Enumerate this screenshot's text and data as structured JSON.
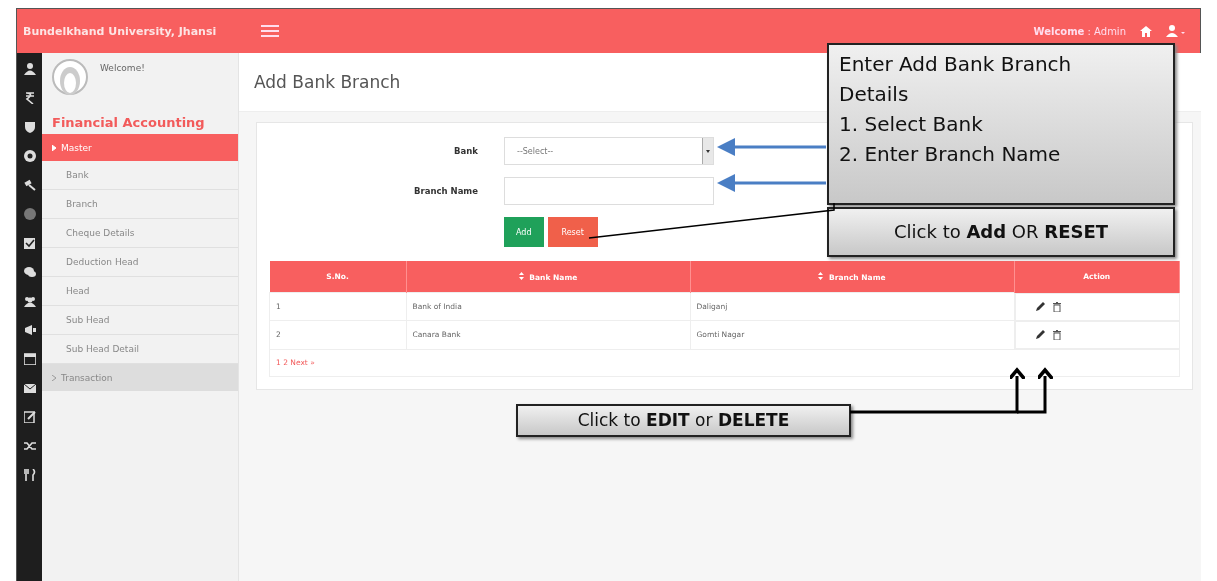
{
  "header": {
    "title": "Bundelkhand University, Jhansi",
    "welcome": "**Welcome** : Admin"
  },
  "sidebar": {
    "greeting": "Welcome!",
    "module": "Financial Accounting",
    "items": [
      {
        "label": "Master",
        "selected": true,
        "expanded": true,
        "children": [
          {
            "label": "Bank"
          },
          {
            "label": "Branch"
          },
          {
            "label": "Cheque Details"
          },
          {
            "label": "Deduction Head"
          },
          {
            "label": "Head"
          },
          {
            "label": "Sub Head"
          },
          {
            "label": "Sub Head Detail"
          }
        ]
      },
      {
        "label": "Transaction",
        "selected": false,
        "expanded": false
      }
    ]
  },
  "page": {
    "title": "Add Bank Branch"
  },
  "form": {
    "fields": [
      {
        "label": "Bank",
        "kind": "select",
        "value": "--Select--"
      },
      {
        "label": "Branch Name",
        "kind": "text"
      }
    ],
    "buttons": [
      {
        "label": "Add",
        "kind": "primary"
      },
      {
        "label": "Reset",
        "kind": "danger"
      }
    ]
  },
  "table": {
    "columns": [
      {
        "label": "S.No.",
        "sortable": false
      },
      {
        "label": "Bank Name",
        "sortable": true
      },
      {
        "label": "Branch Name",
        "sortable": true
      },
      {
        "label": "Action",
        "sortable": false
      }
    ],
    "rows": [
      {
        "sno": "1",
        "bank": "Bank of India",
        "branch": "Daliganj"
      },
      {
        "sno": "2",
        "bank": "Canara Bank",
        "branch": "Gomti Nagar"
      }
    ],
    "pagination": "1 2 Next »"
  },
  "callouts": [
    {
      "kind": "form",
      "lines": [
        "Enter Add Bank Branch Details",
        "1. Select Bank",
        "2. Enter Branch Name"
      ]
    },
    {
      "kind": "buttons",
      "text": "Click to **Add** OR **RESET**"
    },
    {
      "kind": "actions",
      "text": "Click to **EDIT** or **DELETE**"
    }
  ]
}
